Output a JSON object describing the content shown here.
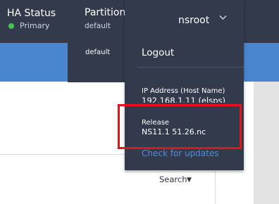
{
  "ha": {
    "title": "HA Status",
    "status": "Primary",
    "status_color": "#3fc54c"
  },
  "partition": {
    "label": "Partition",
    "current": "default",
    "options": [
      "default"
    ]
  },
  "user": {
    "name": "nsroot",
    "menu": {
      "logout": "Logout",
      "ip_label": "IP Address (Host Name)",
      "ip_value": "192.168.1.11 (elsps)",
      "release_label": "Release",
      "release_value": "NS11.1 51.26.nc",
      "check_updates": "Check for updates"
    }
  },
  "content": {
    "search_label": "Search"
  },
  "colors": {
    "nav_bg": "#323a4b",
    "blue_band": "#4a86d0",
    "link": "#4c8fe0",
    "highlight": "#e8101a"
  }
}
